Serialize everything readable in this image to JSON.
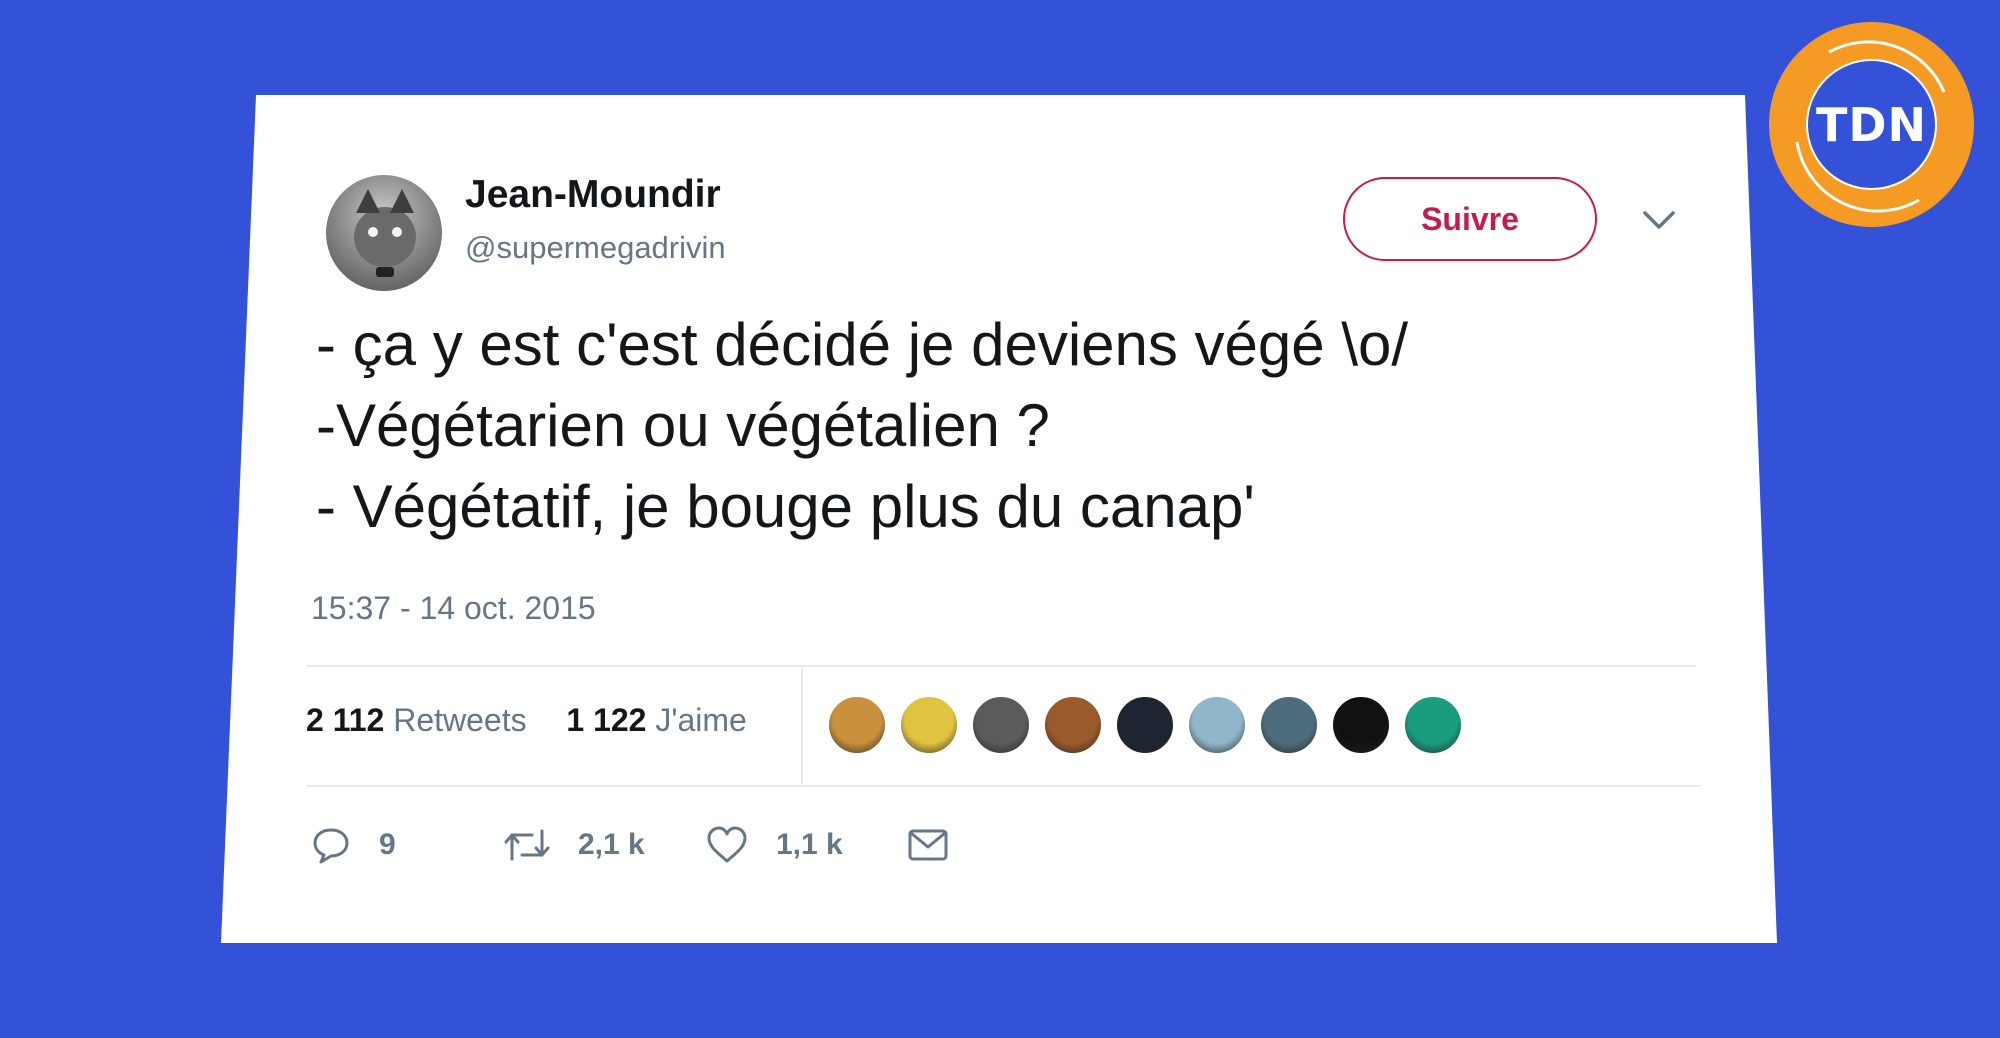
{
  "logo": {
    "text": "TDN"
  },
  "tweet": {
    "author_name": "Jean-Moundir",
    "author_handle": "@supermegadrivin",
    "follow_label": "Suivre",
    "lines": [
      "- ça y est c'est décidé je deviens végé \\o/",
      "-Végétarien ou végétalien ?",
      "- Végétatif, je bouge plus du canap'"
    ],
    "timestamp": "15:37 - 14 oct. 2015",
    "stats": {
      "retweets_count": "2 112",
      "retweets_label": "Retweets",
      "likes_count": "1 122",
      "likes_label": "J'aime"
    },
    "liker_avatars": [
      "#c9903d",
      "#e0c341",
      "#5b5b5b",
      "#9a5a2c",
      "#1d2533",
      "#8fb6c9",
      "#4e6d7c",
      "#111111",
      "#1a9d7e"
    ],
    "actions": {
      "replies": "9",
      "retweets": "2,1 k",
      "likes": "1,1 k"
    }
  },
  "colors": {
    "background": "#3352d8",
    "logo_orange": "#f59b23",
    "follow_red": "#c51d4a",
    "muted_text": "#657786"
  }
}
